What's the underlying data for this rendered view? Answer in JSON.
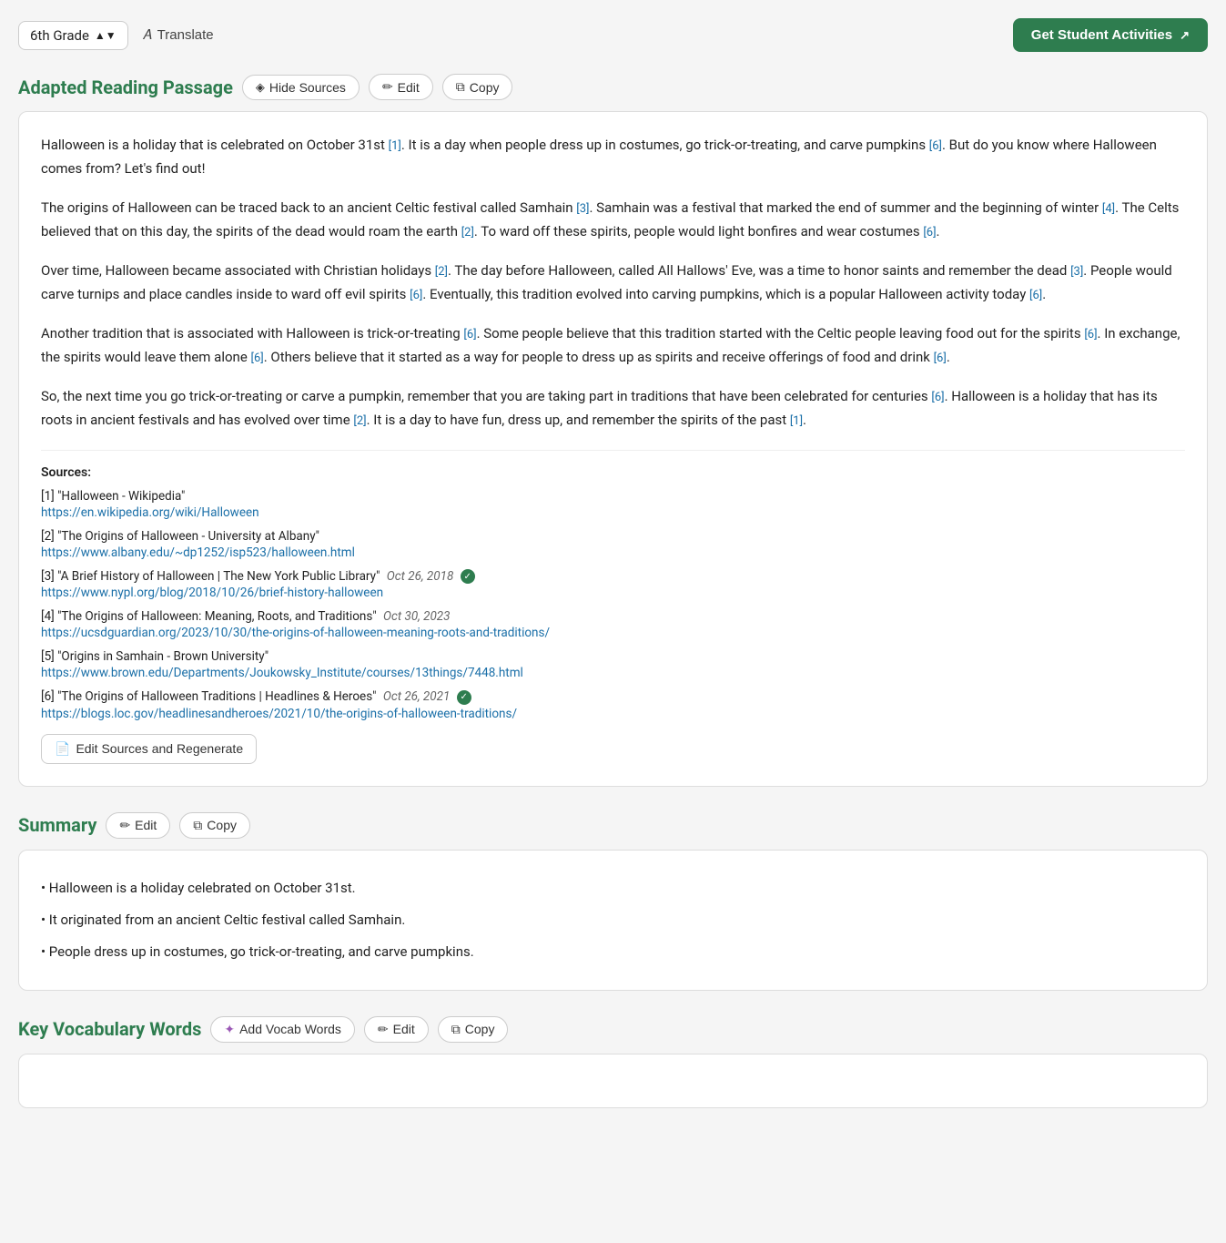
{
  "topBar": {
    "gradeLabel": "6th Grade",
    "translateLabel": "Translate",
    "getActivitiesLabel": "Get Student Activities"
  },
  "adaptedReading": {
    "title": "Adapted Reading Passage",
    "hideSourcesLabel": "Hide Sources",
    "editLabel": "Edit",
    "copyLabel": "Copy",
    "paragraphs": [
      "Halloween is a holiday that is celebrated on October 31st [1]. It is a day when people dress up in costumes, go trick-or-treating, and carve pumpkins [6]. But do you know where Halloween comes from? Let's find out!",
      "The origins of Halloween can be traced back to an ancient Celtic festival called Samhain [3]. Samhain was a festival that marked the end of summer and the beginning of winter [4]. The Celts believed that on this day, the spirits of the dead would roam the earth [2]. To ward off these spirits, people would light bonfires and wear costumes [6].",
      "Over time, Halloween became associated with Christian holidays [2]. The day before Halloween, called All Hallows' Eve, was a time to honor saints and remember the dead [3]. People would carve turnips and place candles inside to ward off evil spirits [6]. Eventually, this tradition evolved into carving pumpkins, which is a popular Halloween activity today [6].",
      "Another tradition that is associated with Halloween is trick-or-treating [6]. Some people believe that this tradition started with the Celtic people leaving food out for the spirits [6]. In exchange, the spirits would leave them alone [6]. Others believe that it started as a way for people to dress up as spirits and receive offerings of food and drink [6].",
      "So, the next time you go trick-or-treating or carve a pumpkin, remember that you are taking part in traditions that have been celebrated for centuries [6]. Halloween is a holiday that has its roots in ancient festivals and has evolved over time [2]. It is a day to have fun, dress up, and remember the spirits of the past [1]."
    ],
    "sourcesLabel": "Sources:",
    "sources": [
      {
        "num": "1",
        "title": "\"Halloween - Wikipedia\"",
        "url": "https://en.wikipedia.org/wiki/Halloween",
        "date": "",
        "verified": false
      },
      {
        "num": "2",
        "title": "\"The Origins of Halloween - University at Albany\"",
        "url": "https://www.albany.edu/~dp1252/isp523/halloween.html",
        "date": "",
        "verified": false
      },
      {
        "num": "3",
        "title": "\"A Brief History of Halloween | The New York Public Library\"",
        "url": "https://www.nypl.org/blog/2018/10/26/brief-history-halloween",
        "date": "Oct 26, 2018",
        "verified": true
      },
      {
        "num": "4",
        "title": "\"The Origins of Halloween: Meaning, Roots, and Traditions\"",
        "url": "https://ucsdguardian.org/2023/10/30/the-origins-of-halloween-meaning-roots-and-traditions/",
        "date": "Oct 30, 2023",
        "verified": false
      },
      {
        "num": "5",
        "title": "\"Origins in Samhain - Brown University\"",
        "url": "https://www.brown.edu/Departments/Joukowsky_Institute/courses/13things/7448.html",
        "date": "",
        "verified": false
      },
      {
        "num": "6",
        "title": "\"The Origins of Halloween Traditions | Headlines & Heroes\"",
        "url": "https://blogs.loc.gov/headlinesandheroes/2021/10/the-origins-of-halloween-traditions/",
        "date": "Oct 26, 2021",
        "verified": true
      }
    ],
    "editSourcesLabel": "Edit Sources and Regenerate"
  },
  "summary": {
    "title": "Summary",
    "editLabel": "Edit",
    "copyLabel": "Copy",
    "bullets": [
      "• Halloween is a holiday celebrated on October 31st.",
      "• It originated from an ancient Celtic festival called Samhain.",
      "• People dress up in costumes, go trick-or-treating, and carve pumpkins."
    ]
  },
  "vocab": {
    "title": "Key Vocabulary Words",
    "addVocabLabel": "Add Vocab Words",
    "editLabel": "Edit",
    "copyLabel": "Copy"
  },
  "icons": {
    "chevron": "⌄",
    "translate": "🔤",
    "externalLink": "↗",
    "eye": "◈",
    "pencil": "✏",
    "copy": "⧉",
    "sparkle": "✦",
    "checkmark": "✓",
    "doc": "📄"
  }
}
